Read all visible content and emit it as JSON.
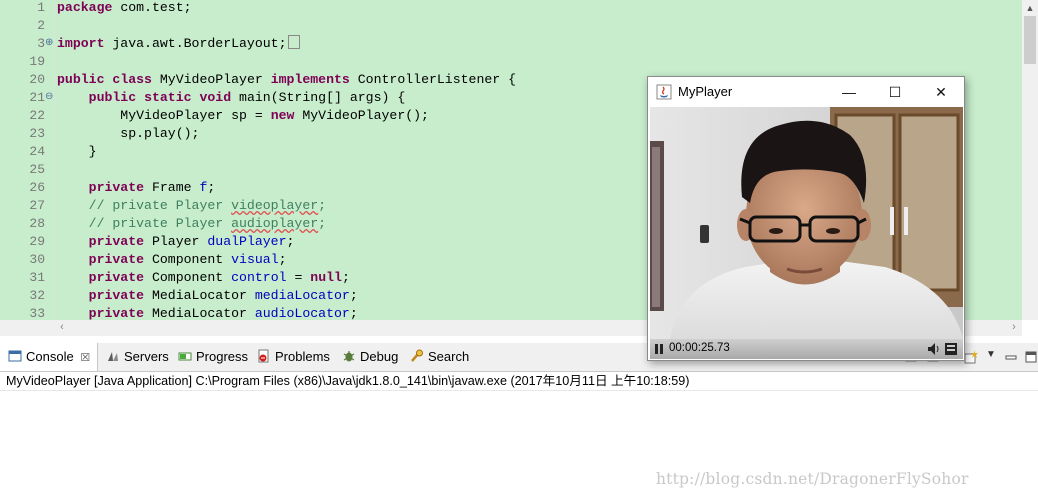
{
  "editor": {
    "lines": [
      {
        "n": "1",
        "fold": "",
        "tokens": [
          {
            "t": "package",
            "c": "kw"
          },
          {
            "t": " com.test;",
            "c": ""
          }
        ]
      },
      {
        "n": "2",
        "fold": "",
        "tokens": []
      },
      {
        "n": "3",
        "fold": "⊕",
        "tokens": [
          {
            "t": "import",
            "c": "kw"
          },
          {
            "t": " java.awt.BorderLayout;",
            "c": ""
          },
          {
            "t": "",
            "c": "marker"
          }
        ]
      },
      {
        "n": "19",
        "fold": "",
        "tokens": []
      },
      {
        "n": "20",
        "fold": "",
        "tokens": [
          {
            "t": "public",
            "c": "kw"
          },
          {
            "t": " ",
            "c": ""
          },
          {
            "t": "class",
            "c": "kw"
          },
          {
            "t": " MyVideoPlayer ",
            "c": ""
          },
          {
            "t": "implements",
            "c": "kw"
          },
          {
            "t": " ControllerListener {",
            "c": ""
          }
        ]
      },
      {
        "n": "21",
        "fold": "⊖",
        "tokens": [
          {
            "t": "    ",
            "c": ""
          },
          {
            "t": "public",
            "c": "kw"
          },
          {
            "t": " ",
            "c": ""
          },
          {
            "t": "static",
            "c": "kw"
          },
          {
            "t": " ",
            "c": ""
          },
          {
            "t": "void",
            "c": "kw"
          },
          {
            "t": " main(String[] args) {",
            "c": ""
          }
        ]
      },
      {
        "n": "22",
        "fold": "",
        "tokens": [
          {
            "t": "        MyVideoPlayer sp = ",
            "c": ""
          },
          {
            "t": "new",
            "c": "kw"
          },
          {
            "t": " MyVideoPlayer();",
            "c": ""
          }
        ]
      },
      {
        "n": "23",
        "fold": "",
        "tokens": [
          {
            "t": "        sp.play();",
            "c": ""
          }
        ]
      },
      {
        "n": "24",
        "fold": "",
        "tokens": [
          {
            "t": "    }",
            "c": ""
          }
        ]
      },
      {
        "n": "25",
        "fold": "",
        "tokens": []
      },
      {
        "n": "26",
        "fold": "",
        "tokens": [
          {
            "t": "    ",
            "c": ""
          },
          {
            "t": "private",
            "c": "kw"
          },
          {
            "t": " Frame ",
            "c": ""
          },
          {
            "t": "f",
            "c": "fld"
          },
          {
            "t": ";",
            "c": ""
          }
        ]
      },
      {
        "n": "27",
        "fold": "",
        "tokens": [
          {
            "t": "    // private Player ",
            "c": "cmt"
          },
          {
            "t": "videoplayer",
            "c": "cmt sq"
          },
          {
            "t": ";",
            "c": "cmt"
          }
        ]
      },
      {
        "n": "28",
        "fold": "",
        "tokens": [
          {
            "t": "    // private Player ",
            "c": "cmt"
          },
          {
            "t": "audioplayer",
            "c": "cmt sq"
          },
          {
            "t": ";",
            "c": "cmt"
          }
        ]
      },
      {
        "n": "29",
        "fold": "",
        "tokens": [
          {
            "t": "    ",
            "c": ""
          },
          {
            "t": "private",
            "c": "kw"
          },
          {
            "t": " Player ",
            "c": ""
          },
          {
            "t": "dualPlayer",
            "c": "fld"
          },
          {
            "t": ";",
            "c": ""
          }
        ]
      },
      {
        "n": "30",
        "fold": "",
        "tokens": [
          {
            "t": "    ",
            "c": ""
          },
          {
            "t": "private",
            "c": "kw"
          },
          {
            "t": " Component ",
            "c": ""
          },
          {
            "t": "visual",
            "c": "fld"
          },
          {
            "t": ";",
            "c": ""
          }
        ]
      },
      {
        "n": "31",
        "fold": "",
        "tokens": [
          {
            "t": "    ",
            "c": ""
          },
          {
            "t": "private",
            "c": "kw"
          },
          {
            "t": " Component ",
            "c": ""
          },
          {
            "t": "control",
            "c": "fld"
          },
          {
            "t": " = ",
            "c": ""
          },
          {
            "t": "null",
            "c": "kw"
          },
          {
            "t": ";",
            "c": ""
          }
        ]
      },
      {
        "n": "32",
        "fold": "",
        "tokens": [
          {
            "t": "    ",
            "c": ""
          },
          {
            "t": "private",
            "c": "kw"
          },
          {
            "t": " MediaLocator ",
            "c": ""
          },
          {
            "t": "mediaLocator",
            "c": "fld"
          },
          {
            "t": ";",
            "c": ""
          }
        ]
      },
      {
        "n": "33",
        "fold": "",
        "tokens": [
          {
            "t": "    ",
            "c": ""
          },
          {
            "t": "private",
            "c": "kw"
          },
          {
            "t": " MediaLocator ",
            "c": ""
          },
          {
            "t": "audioLocator",
            "c": "fld"
          },
          {
            "t": ";",
            "c": ""
          }
        ]
      }
    ],
    "background_color": "#c7edcc",
    "keyword_color": "#7f0055",
    "field_color": "#0000c0",
    "comment_color": "#3f7f5f"
  },
  "views": {
    "tabs": [
      {
        "label": "Console",
        "icon": "console-icon",
        "active": true,
        "close": "☒"
      },
      {
        "label": "Servers",
        "icon": "servers-icon"
      },
      {
        "label": "Progress",
        "icon": "progress-icon"
      },
      {
        "label": "Problems",
        "icon": "problems-icon"
      },
      {
        "label": "Debug",
        "icon": "debug-icon"
      },
      {
        "label": "Search",
        "icon": "search-icon"
      }
    ]
  },
  "console": {
    "description": "MyVideoPlayer [Java Application] C:\\Program Files (x86)\\Java\\jdk1.8.0_141\\bin\\javaw.exe (2017年10月11日 上午10:18:59)"
  },
  "player": {
    "title": "MyPlayer",
    "time": "00:00:25.73",
    "minimize": "—",
    "maximize": "☐",
    "close": "✕"
  },
  "watermark": "http://blog.csdn.net/DragonerFlySohor"
}
